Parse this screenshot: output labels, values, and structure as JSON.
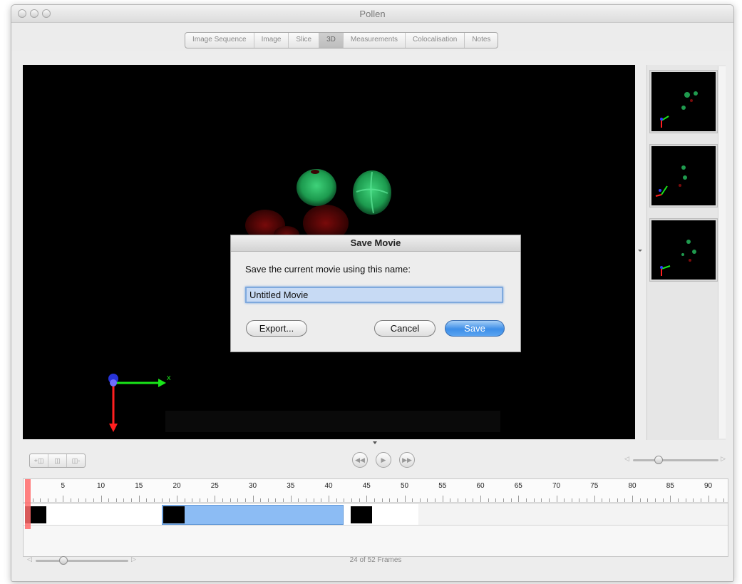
{
  "window": {
    "title": "Pollen"
  },
  "tabs": [
    {
      "label": "Image Sequence",
      "active": false
    },
    {
      "label": "Image",
      "active": false
    },
    {
      "label": "Slice",
      "active": false
    },
    {
      "label": "3D",
      "active": true
    },
    {
      "label": "Measurements",
      "active": false
    },
    {
      "label": "Colocalisation",
      "active": false
    },
    {
      "label": "Notes",
      "active": false
    }
  ],
  "viewer": {
    "axis_x_label": "x"
  },
  "dialog": {
    "title": "Save Movie",
    "prompt": "Save the current movie using this name:",
    "name_value": "Untitled Movie",
    "export_label": "Export...",
    "cancel_label": "Cancel",
    "save_label": "Save"
  },
  "timeline": {
    "ticks": [
      "5",
      "10",
      "15",
      "20",
      "25",
      "30",
      "35",
      "40",
      "45",
      "50",
      "55",
      "60",
      "65",
      "70",
      "75",
      "80",
      "85",
      "90"
    ],
    "selection_start_frame": 18,
    "selection_end_frame": 42,
    "current_frame": 1
  },
  "status": {
    "frames_label": "24 of 52 Frames"
  },
  "zoom_slider": {
    "value": 0.3
  },
  "speed_slider": {
    "value": 0.3
  },
  "colors": {
    "accent_blue": "#3d8ee8",
    "selection_blue": "#8cbcf4",
    "playhead_red": "#ff6a6a"
  }
}
